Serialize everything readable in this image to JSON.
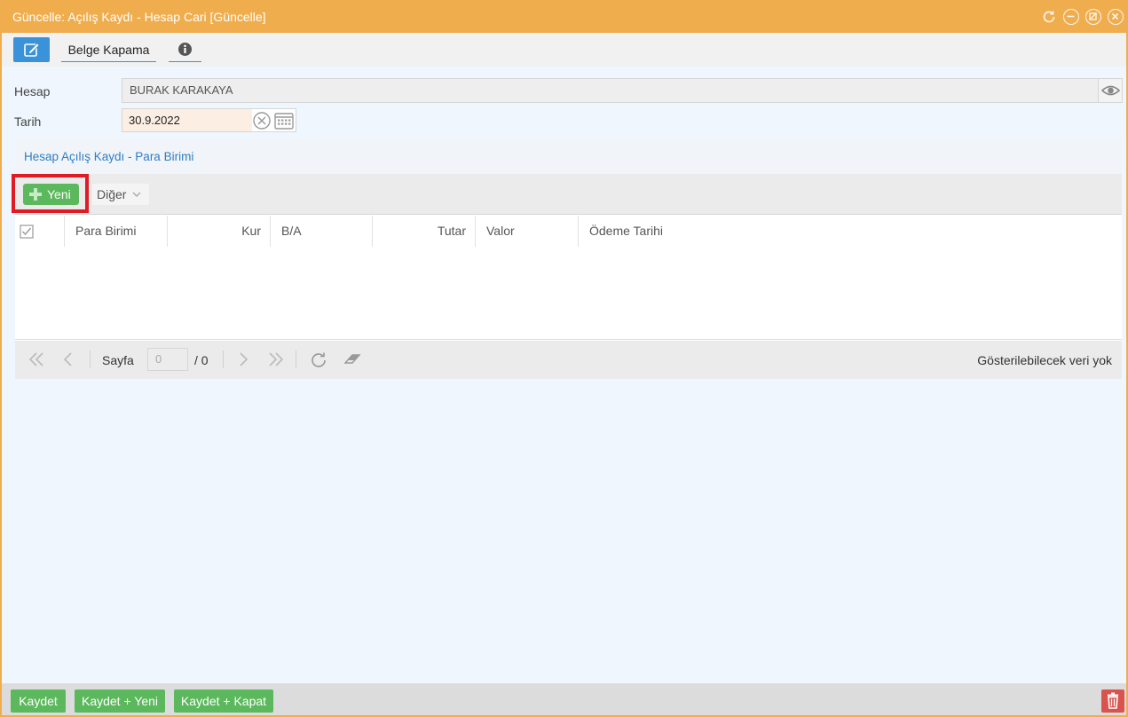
{
  "window": {
    "title": "Güncelle: Açılış Kaydı - Hesap Cari [Güncelle]",
    "controls": [
      "refresh-icon",
      "minimize-icon",
      "maximize-icon",
      "close-icon"
    ]
  },
  "toolbar": {
    "edit_icon": "edit-icon",
    "belge_kapama": "Belge Kapama",
    "info_icon": "info-icon"
  },
  "form": {
    "hesap_label": "Hesap",
    "hesap_value": "BURAK KARAKAYA",
    "tarih_label": "Tarih",
    "tarih_value": "30.9.2022"
  },
  "panel": {
    "title": "Hesap Açılış Kaydı - Para Birimi",
    "new_button": "Yeni",
    "other_button": "Diğer",
    "columns": [
      "Para Birimi",
      "Kur",
      "B/A",
      "Tutar",
      "Valor",
      "Ödeme Tarihi"
    ]
  },
  "pager": {
    "page_label": "Sayfa",
    "page_value": "0",
    "page_total": "/ 0",
    "empty_message": "Gösterilebilecek veri yok"
  },
  "footer": {
    "save": "Kaydet",
    "save_new": "Kaydet + Yeni",
    "save_close": "Kaydet + Kapat"
  },
  "colors": {
    "accent": "#f0ad4e",
    "primary": "#3a93d8",
    "success": "#5cb85c",
    "danger": "#d9534f",
    "highlight": "#e01b24"
  }
}
